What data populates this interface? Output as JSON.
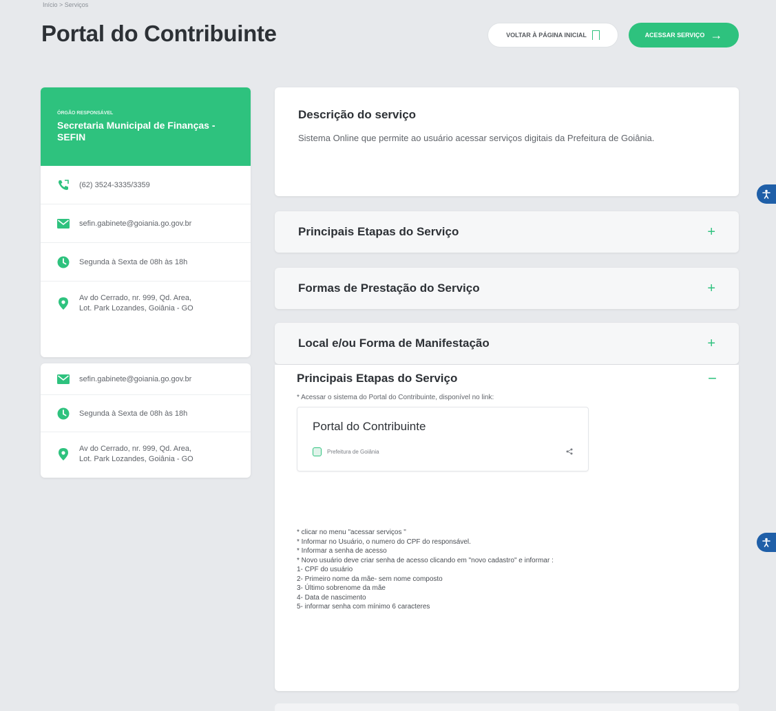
{
  "breadcrumb": "Início > Serviços",
  "page": {
    "title": "Portal do Contribuinte",
    "favorite_label": "Voltar à página inicial",
    "access_label": "Acessar serviço"
  },
  "side_primary": {
    "org_label": "Órgão responsável",
    "org_name": "Secretaria Municipal de Finanças - SEFIN",
    "phone": "(62) 3524-3335/3359",
    "email": "sefin.gabinete@goiania.go.gov.br",
    "hours": "Segunda à Sexta de 08h às 18h",
    "address_line1": "Av do Cerrado, nr. 999, Qd. Area,",
    "address_line2": "Lot. Park Lozandes, Goiânia - GO"
  },
  "side_secondary": {
    "email": "sefin.gabinete@goiania.go.gov.br",
    "hours": "Segunda à Sexta de 08h às 18h",
    "address_line1": "Av do Cerrado, nr. 999, Qd. Area,",
    "address_line2": "Lot. Park Lozandes, Goiânia - GO"
  },
  "description": {
    "title": "Descrição do serviço",
    "text": "Sistema Online que permite ao usuário acessar serviços digitais da Prefeitura de Goiânia."
  },
  "accordion": [
    {
      "label": "Principais Etapas do Serviço",
      "toggle": "+"
    },
    {
      "label": "Formas de Prestação do Serviço",
      "toggle": "+"
    },
    {
      "label": "Local e/ou Forma de Manifestação",
      "toggle": "+"
    }
  ],
  "detail": {
    "title": "Principais Etapas do Serviço",
    "toggle": "−",
    "intro": "* Acessar o sistema do Portal do Contribuinte, disponível no link:",
    "link_card": {
      "title": "Portal do Contribuinte",
      "source": "Prefeitura de Goiânia"
    },
    "steps": [
      "* clicar no menu \"acessar serviços \"",
      "* Informar no Usuário, o numero do CPF do responsável.",
      "* Informar a senha de acesso",
      "* Novo usuário deve criar senha de acesso clicando em \"novo cadastro\" e informar :",
      "1- CPF do usuário",
      "2- Primeiro nome da mãe- sem nome composto",
      "3- Último sobrenome da mãe",
      "4- Data de nascimento",
      "5- informar senha com mínimo 6 caracteres"
    ]
  }
}
